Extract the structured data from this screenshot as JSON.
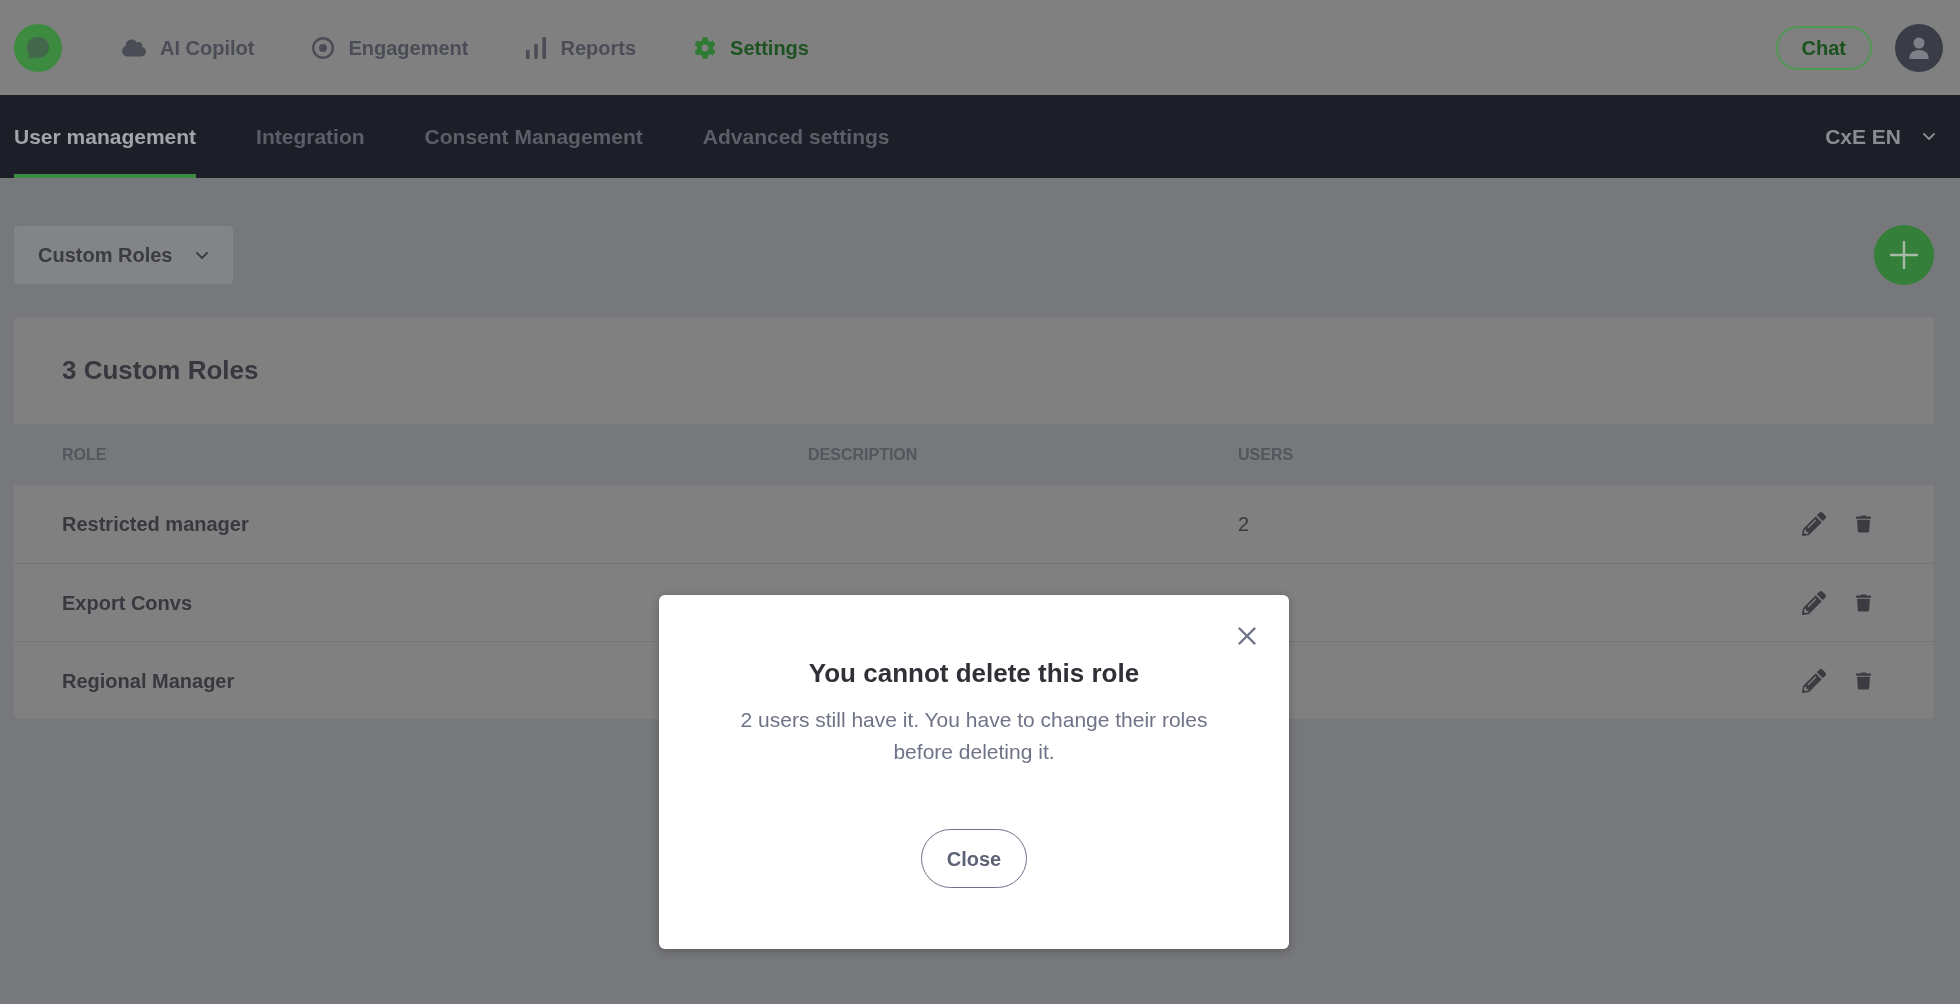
{
  "top_nav": {
    "items": [
      {
        "label": "AI Copilot",
        "selected": false
      },
      {
        "label": "Engagement",
        "selected": false
      },
      {
        "label": "Reports",
        "selected": false
      },
      {
        "label": "Settings",
        "selected": true
      }
    ],
    "chat_button": "Chat"
  },
  "sub_nav": {
    "tabs": [
      {
        "label": "User management",
        "selected": true
      },
      {
        "label": "Integration",
        "selected": false
      },
      {
        "label": "Consent Management",
        "selected": false
      },
      {
        "label": "Advanced settings",
        "selected": false
      }
    ],
    "language": "CxE EN"
  },
  "role_filter": "Custom Roles",
  "roles_table": {
    "title": "3 Custom Roles",
    "columns": [
      "ROLE",
      "DESCRIPTION",
      "USERS"
    ],
    "rows": [
      {
        "role": "Restricted manager",
        "users": "2"
      },
      {
        "role": "Export Convs"
      },
      {
        "role": "Regional Manager"
      }
    ]
  },
  "dialog": {
    "title": "You cannot delete this role",
    "message": "2 users still have it. You have to change their roles before deleting it.",
    "button": "Close"
  }
}
